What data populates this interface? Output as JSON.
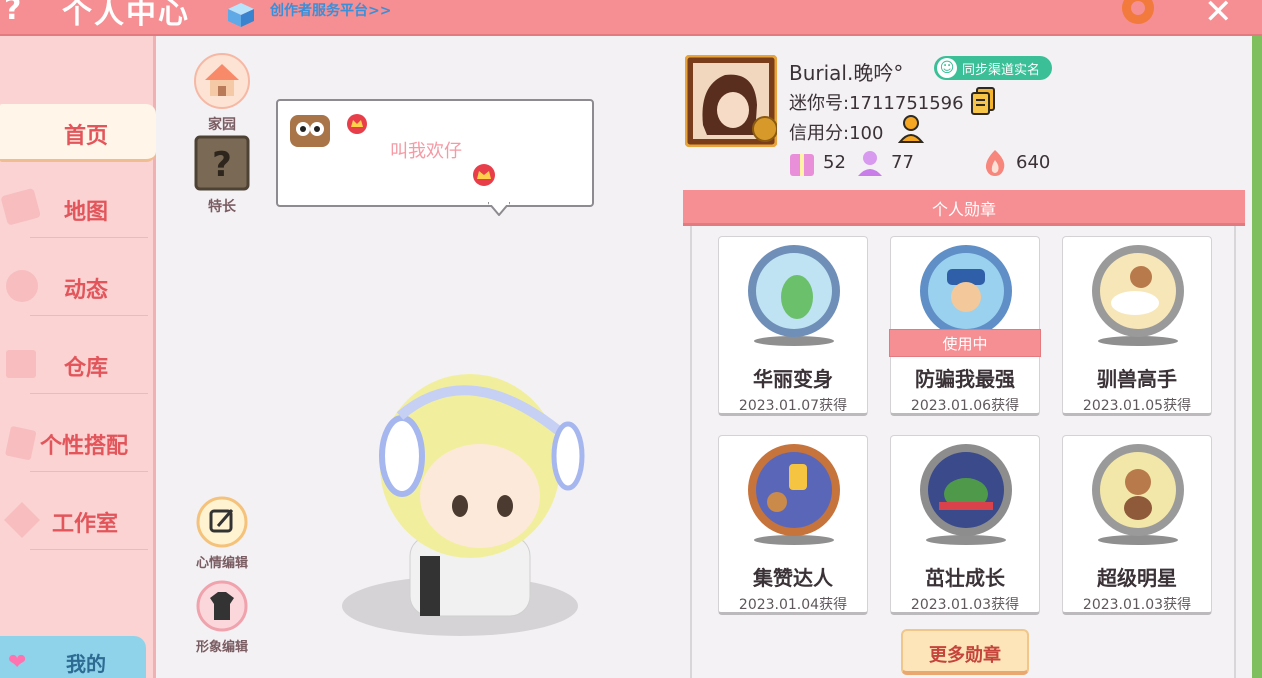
{
  "header": {
    "title": "个人中心",
    "creator_link": "创作者服务平台>>"
  },
  "sidebar": {
    "items": [
      {
        "label": "首页",
        "active": true
      },
      {
        "label": "地图",
        "active": false
      },
      {
        "label": "动态",
        "active": false
      },
      {
        "label": "仓库",
        "active": false
      },
      {
        "label": "个性搭配",
        "active": false
      },
      {
        "label": "工作室",
        "active": false
      }
    ],
    "mine_label": "我的"
  },
  "center": {
    "home_label": "家园",
    "skill_label": "特长",
    "bubble_text": "叫我欢仔",
    "mood_edit_label": "心情编辑",
    "look_edit_label": "形象编辑"
  },
  "profile": {
    "name": "Burial.晚吟°",
    "sync_label": "同步渠道实名",
    "mini_id": "迷你号:1711751596",
    "credit": "信用分:100",
    "stats": [
      {
        "icon": "gift-icon",
        "value": "52"
      },
      {
        "icon": "fans-icon",
        "value": "77"
      },
      {
        "icon": "flame-icon",
        "value": "640"
      }
    ]
  },
  "medals": {
    "header": "个人勋章",
    "in_use_label": "使用中",
    "items": [
      {
        "name": "华丽变身",
        "date": "2023.01.07获得",
        "in_use": false,
        "ring": "#6f8fb8",
        "inner": "#bfe3f2"
      },
      {
        "name": "防骗我最强",
        "date": "2023.01.06获得",
        "in_use": true,
        "ring": "#5f8fc6",
        "inner": "#9ad1ee"
      },
      {
        "name": "驯兽高手",
        "date": "2023.01.05获得",
        "in_use": false,
        "ring": "#9a9a9a",
        "inner": "#f6e6b8"
      },
      {
        "name": "集赞达人",
        "date": "2023.01.04获得",
        "in_use": false,
        "ring": "#c6733c",
        "inner": "#5a67b8"
      },
      {
        "name": "茁壮成长",
        "date": "2023.01.03获得",
        "in_use": false,
        "ring": "#8d8d8d",
        "inner": "#3a4a8a"
      },
      {
        "name": "超级明星",
        "date": "2023.01.03获得",
        "in_use": false,
        "ring": "#9a9a9a",
        "inner": "#f2e6a8"
      }
    ],
    "more_label": "更多勋章"
  },
  "colors": {
    "accent": "#f58f93",
    "sidebar_bg": "#fbd3d3",
    "nav_text": "#e2565b"
  }
}
